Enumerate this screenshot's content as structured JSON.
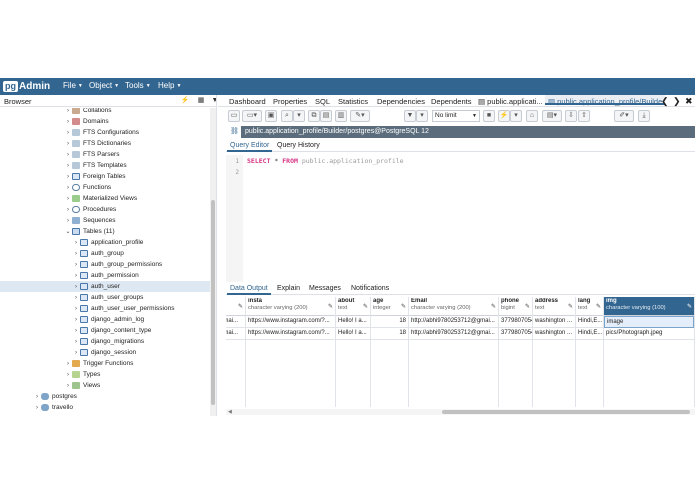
{
  "navbar": {
    "logo_pg": "pg",
    "logo_admin": "Admin",
    "menus": [
      "File",
      "Object",
      "Tools",
      "Help"
    ]
  },
  "browser": {
    "title": "Browser",
    "tree": [
      {
        "label": "Collations",
        "icon": "collation-icon",
        "toggle": ">"
      },
      {
        "label": "Domains",
        "icon": "domain-icon",
        "toggle": ">"
      },
      {
        "label": "FTS Configurations",
        "icon": "fts-icon",
        "toggle": ">"
      },
      {
        "label": "FTS Dictionaries",
        "icon": "fts-icon",
        "toggle": ">"
      },
      {
        "label": "FTS Parsers",
        "icon": "fts-icon",
        "toggle": ">"
      },
      {
        "label": "FTS Templates",
        "icon": "fts-icon",
        "toggle": ">"
      },
      {
        "label": "Foreign Tables",
        "icon": "table-icon",
        "toggle": ">"
      },
      {
        "label": "Functions",
        "icon": "function-icon",
        "toggle": ">"
      },
      {
        "label": "Materialized Views",
        "icon": "mview-icon",
        "toggle": ">"
      },
      {
        "label": "Procedures",
        "icon": "function-icon",
        "toggle": ">"
      },
      {
        "label": "Sequences",
        "icon": "sequence-icon",
        "toggle": ">"
      },
      {
        "label": "Tables (11)",
        "icon": "tables-icon",
        "toggle": "v"
      },
      {
        "label": "application_profile",
        "icon": "table-icon",
        "toggle": ">"
      },
      {
        "label": "auth_group",
        "icon": "table-icon",
        "toggle": ">"
      },
      {
        "label": "auth_group_permissions",
        "icon": "table-icon",
        "toggle": ">"
      },
      {
        "label": "auth_permission",
        "icon": "table-icon",
        "toggle": ">"
      },
      {
        "label": "auth_user",
        "icon": "table-icon",
        "toggle": ">"
      },
      {
        "label": "auth_user_groups",
        "icon": "table-icon",
        "toggle": ">"
      },
      {
        "label": "auth_user_user_permissions",
        "icon": "table-icon",
        "toggle": ">"
      },
      {
        "label": "django_admin_log",
        "icon": "table-icon",
        "toggle": ">"
      },
      {
        "label": "django_content_type",
        "icon": "table-icon",
        "toggle": ">"
      },
      {
        "label": "django_migrations",
        "icon": "table-icon",
        "toggle": ">"
      },
      {
        "label": "django_session",
        "icon": "table-icon",
        "toggle": ">"
      },
      {
        "label": "Trigger Functions",
        "icon": "trigger-icon",
        "toggle": ">"
      },
      {
        "label": "Types",
        "icon": "type-icon",
        "toggle": ">"
      },
      {
        "label": "Views",
        "icon": "view-icon",
        "toggle": ">"
      },
      {
        "label": "postgres",
        "icon": "database-icon",
        "toggle": ">"
      },
      {
        "label": "travello",
        "icon": "database-icon",
        "toggle": ">"
      }
    ]
  },
  "main_tabs": [
    "Dashboard",
    "Properties",
    "SQL",
    "Statistics",
    "Dependencies",
    "Dependents",
    "public.applicati...",
    "public.application_profile/Builde"
  ],
  "toolbar": {
    "limit_label": "No limit"
  },
  "connection": {
    "label": "public.application_profile/Builder/postgres@PostgreSQL 12"
  },
  "editor_tabs": [
    "Query Editor",
    "Query History"
  ],
  "editor": {
    "line_numbers": [
      "1",
      "2"
    ],
    "kw_select": "SELECT",
    "op_star": "*",
    "kw_from": "FROM",
    "schema": "public",
    "dot": ".",
    "table": "application_profile"
  },
  "output_tabs": [
    "Data Output",
    "Explain",
    "Messages",
    "Notifications"
  ],
  "grid": {
    "columns": [
      {
        "name": "",
        "type": "",
        "cells": [
          "gmai...",
          "gmai..."
        ]
      },
      {
        "name": "insta",
        "type": "character varying (200)",
        "cells": [
          "https://www.instagram.com/?...",
          "https://www.instagram.com/?..."
        ]
      },
      {
        "name": "about",
        "type": "text",
        "cells": [
          "Hello! I a...",
          "Hello! I a..."
        ]
      },
      {
        "name": "age",
        "type": "integer",
        "cells": [
          "18",
          "18"
        ]
      },
      {
        "name": "Email",
        "type": "character varying (200)",
        "cells": [
          "http://abhi9780253712@gmai...",
          "http://abhi9780253712@gmai..."
        ]
      },
      {
        "name": "phone",
        "type": "bigint",
        "cells": [
          "3779807054",
          "3779807054"
        ]
      },
      {
        "name": "address",
        "type": "text",
        "cells": [
          "washington ...",
          "washington ..."
        ]
      },
      {
        "name": "lang",
        "type": "text",
        "cells": [
          "Hindi,E...",
          "Hindi,E..."
        ]
      },
      {
        "name": "img",
        "type": "character varying (100)",
        "cells": [
          "image",
          "pics/Photograph.jpeg"
        ]
      }
    ]
  },
  "colors": {
    "brand": "#326690",
    "connection_bar": "#5b6d7c",
    "keyword": "#d63384",
    "selected_row": "#dde8f3"
  }
}
